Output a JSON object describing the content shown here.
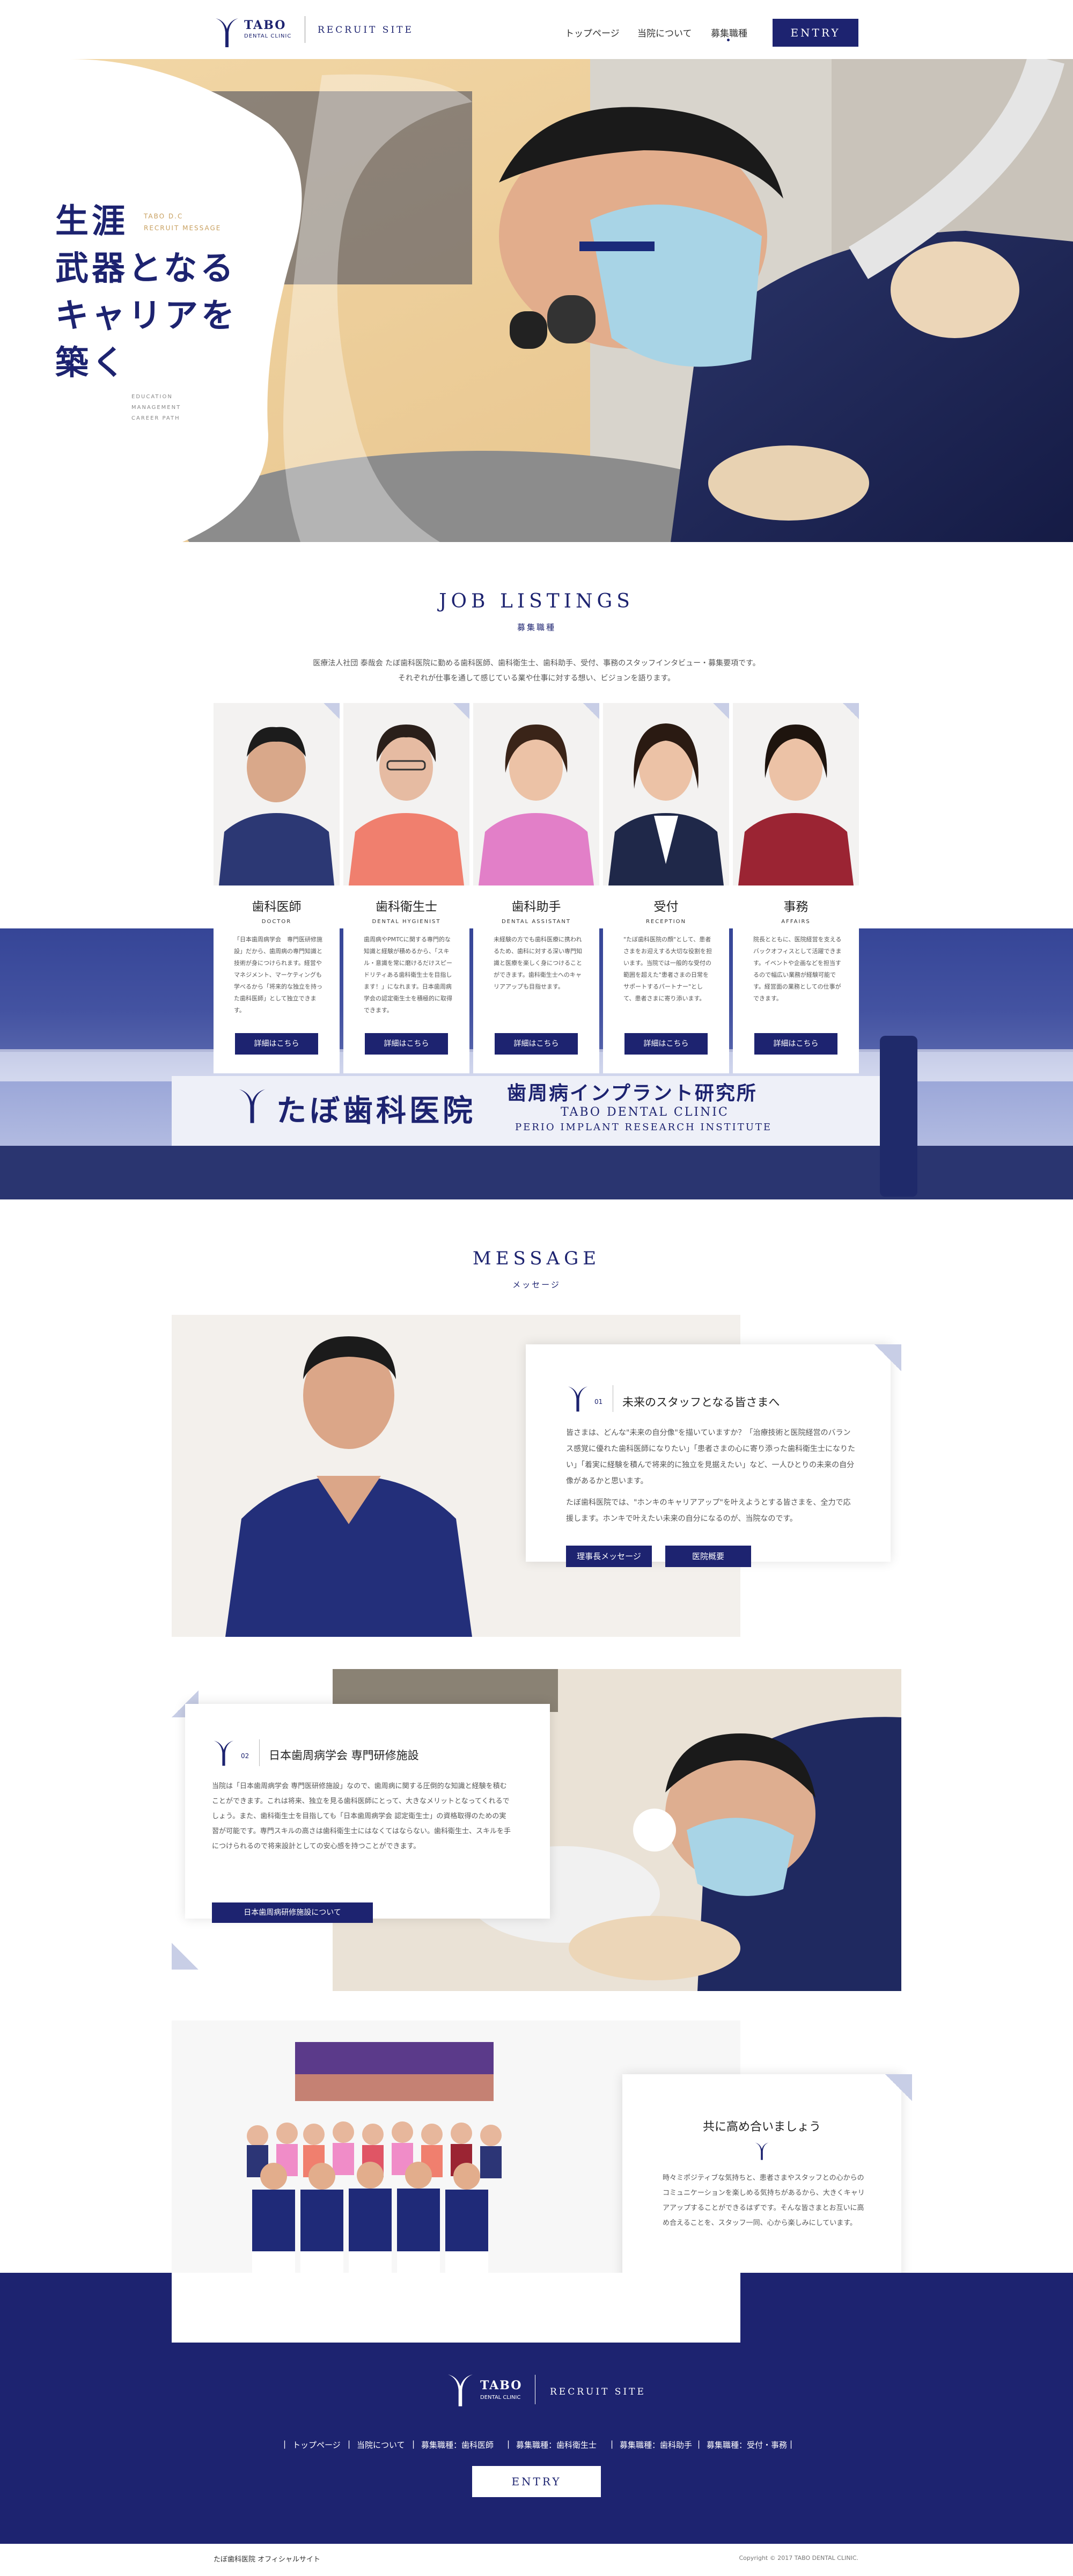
{
  "header": {
    "logo_name": "TABO",
    "logo_sub": "DENTAL CLINIC",
    "site_label": "RECRUIT SITE",
    "nav": [
      {
        "label": "トップページ"
      },
      {
        "label": "当院について"
      },
      {
        "label": "募集職種"
      }
    ],
    "entry": "ENTRY"
  },
  "hero": {
    "lines": [
      "生涯",
      "武器となる",
      "キャリアを",
      "築く"
    ],
    "tag_en_1": "TABO D.C",
    "tag_en_2": "RECRUIT MESSAGE",
    "sub_en": [
      "EDUCATION",
      "MANAGEMENT",
      "CAREER PATH"
    ]
  },
  "jobs": {
    "title": "JOB LISTINGS",
    "subtitle": "募集職種",
    "intro_1": "医療法人社団 泰哉会 たぼ歯科医院に勤める歯科医師、歯科衛生士、歯科助手、受付、事務のスタッフインタビュー・募集要項です。",
    "intro_2": "それぞれが仕事を通して感じている業や仕事に対する想い、ビジョンを語ります。",
    "cards": [
      {
        "title": "歯科医師",
        "sub": "DOCTOR",
        "text": "「日本歯周病学会　専門医研修施設」だから、歯周病の専門知識と技術が身につけられます。経営やマネジメント、マーケティングも学べるから「将来的な独立を持った歯科医師」として独立できます。",
        "button": "詳細はこちら"
      },
      {
        "title": "歯科衛生士",
        "sub": "DENTAL HYGIENIST",
        "text": "歯周病やPMTCに関する専門的な知識と経験が積めるから、「スキル・意識を常に磨けるだけスピードリティある歯科衛生士を目指します！」になれます。日本歯周病学会の認定衛生士を積極的に取得できます。",
        "button": "詳細はこちら"
      },
      {
        "title": "歯科助手",
        "sub": "DENTAL ASSISTANT",
        "text": "未経験の方でも歯科医療に携われるため、歯科に対する深い専門知識と医療を楽しく身につけることができます。歯科衛生士へのキャリアアップも目指せます。",
        "button": "詳細はこちら"
      },
      {
        "title": "受付",
        "sub": "RECEPTION",
        "text": "\"たぼ歯科医院の顔\"として、患者さまをお迎えする大切な役割を担います。当院では一般的な受付の範囲を超えた\"患者さまの日常をサポートするパートナー\"として、患者さまに寄り添います。",
        "button": "詳細はこちら"
      },
      {
        "title": "事務",
        "sub": "AFFAIRS",
        "text": "院長とともに、医院経営を支えるバックオフィスとして活躍できます。イベントや企画などを担当するので幅広い業務が経験可能です。経営面の業務としての仕事ができます。",
        "button": "詳細はこちら"
      }
    ],
    "sign_main": "たぼ歯科医院",
    "sign_right": "歯周病インプラント研究所",
    "sign_en_1": "TABO DENTAL CLINIC",
    "sign_en_2": "PERIO IMPLANT RESEARCH INSTITUTE"
  },
  "message": {
    "title": "MESSAGE",
    "subtitle": "メッセージ",
    "block1": {
      "num": "01",
      "heading": "未来のスタッフとなる皆さまへ",
      "p1": "皆さまは、どんな\"未来の自分像\"を描いていますか？「治療技術と医院経営のバランス感覚に優れた歯科医師になりたい」「患者さまの心に寄り添った歯科衛生士になりたい」「着実に経験を積んで将来的に独立を見据えたい」など、一人ひとりの未来の自分像があるかと思います。",
      "p2": "たぼ歯科医院では、\"ホンキのキャリアアップ\"を叶えようとする皆さまを、全力で応援します。ホンキで叶えたい未来の自分になるのが、当院なのです。",
      "btn1": "理事長メッセージ",
      "btn2": "医院概要"
    },
    "block2": {
      "num": "02",
      "heading": "日本歯周病学会 専門研修施設",
      "p1": "当院は「日本歯周病学会 専門医研修施設」なので、歯周病に関する圧倒的な知識と経験を積むことができます。これは将来、独立を見る歯科医師にとって、大きなメリットとなってくれるでしょう。また、歯科衛生士を目指しても「日本歯周病学会 認定衛生士」の資格取得のための実習が可能です。専門スキルの高さは歯科衛生士にはなくてはならない。歯科衛生士、スキルを手につけられるので将来設計としての安心感を持つことができます。",
      "btn": "日本歯周病研修施設について"
    },
    "block3": {
      "heading": "共に高め合いましょう",
      "p1": "時々ミポジティブな気持ちと、患者さまやスタッフとの心からのコミュニケーションを楽しめる気持ちがあるから、大きくキャリアアップすることができるはずです。そんな皆さまとお互いに高め合えることを、スタッフ一同、心から楽しみにしています。"
    }
  },
  "footer": {
    "logo_name": "TABO",
    "logo_sub": "DENTAL CLINIC",
    "site_label": "RECRUIT SITE",
    "nav": [
      {
        "label": "トップページ"
      },
      {
        "label": "当院について"
      },
      {
        "label": "募集職種：歯科医師"
      },
      {
        "label": "募集職種：歯科衛生士"
      },
      {
        "label": "募集職種：歯科助手"
      },
      {
        "label": "募集職種：受付・事務"
      }
    ],
    "entry": "ENTRY",
    "official": "たぼ歯科医院 オフィシャルサイト",
    "copyright": "Copyright © 2017 TABO DENTAL CLINIC."
  },
  "colors": {
    "navy": "#1d2370",
    "gold": "#c8a060"
  }
}
